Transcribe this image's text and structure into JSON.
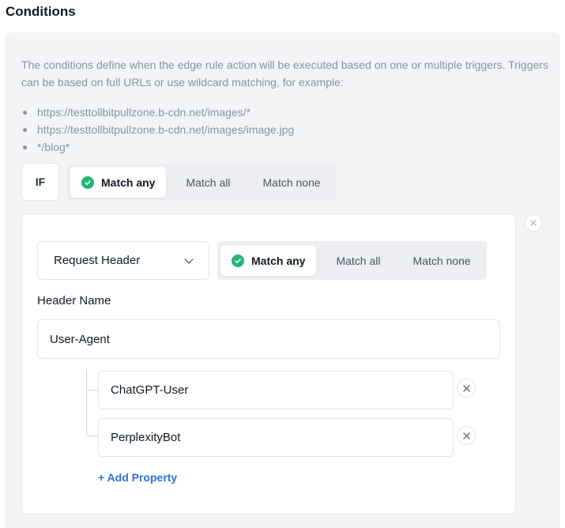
{
  "section": {
    "title": "Conditions"
  },
  "description": "The conditions define when the edge rule action will be executed based on one or multiple triggers. Triggers can be based on full URLs or use wildcard matching, for example:",
  "examples": [
    "https://testtollbitpullzone.b-cdn.net/images/*",
    "https://testtollbitpullzone.b-cdn.net/images/image.jpg",
    "*/blog*"
  ],
  "if_label": "IF",
  "top_match": {
    "options": [
      "Match any",
      "Match all",
      "Match none"
    ],
    "selected": "Match any"
  },
  "condition": {
    "trigger": "Request Header",
    "match": {
      "options": [
        "Match any",
        "Match all",
        "Match none"
      ],
      "selected": "Match any"
    },
    "header_name_label": "Header Name",
    "header_name_value": "User-Agent",
    "properties": [
      "ChatGPT-User",
      "PerplexityBot"
    ],
    "add_property_label": "+ Add Property"
  },
  "colors": {
    "accent": "#2f6fd6",
    "check": "#22b573"
  }
}
